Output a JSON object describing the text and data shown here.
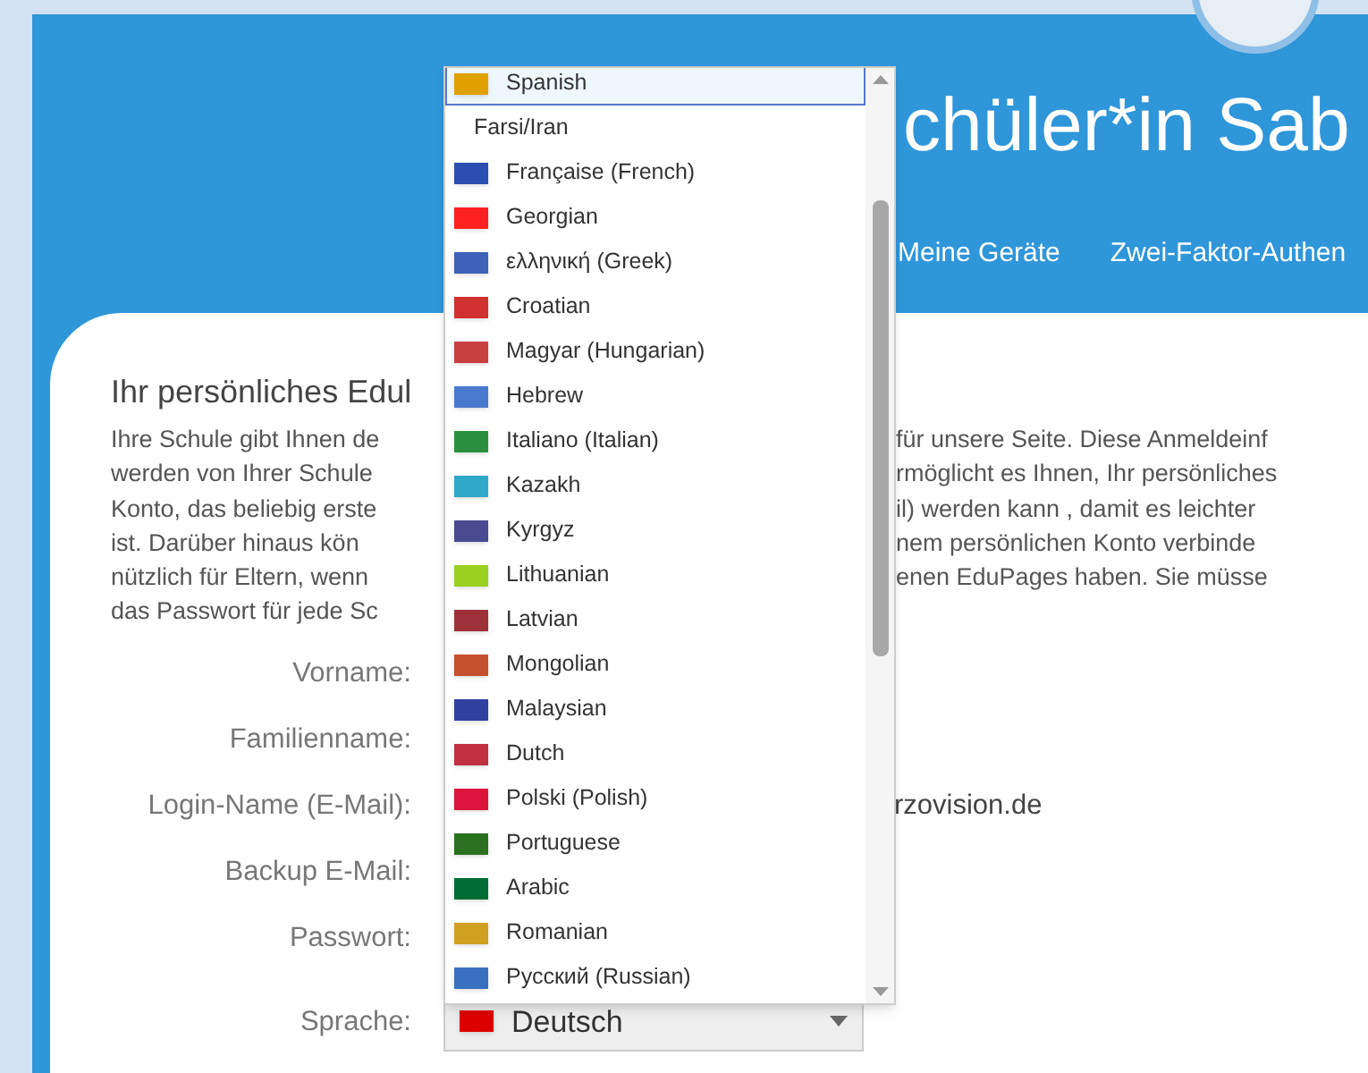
{
  "header": {
    "title": "chüler*in Sab",
    "nav": [
      "Meine Geräte",
      "Zwei-Faktor-Authen"
    ]
  },
  "intro": {
    "heading": "Ihr persönliches Edul",
    "lines": [
      {
        "left": "Ihre Schule gibt Ihnen de",
        "right": "für unsere Seite. Diese Anmeldeinf"
      },
      {
        "left": "werden von Ihrer Schule",
        "right": "rmöglicht es Ihnen, Ihr persönliches"
      },
      {
        "left": "Konto, das beliebig erste",
        "right": "il) werden kann , damit es leichter"
      },
      {
        "left": "ist. Darüber hinaus kön",
        "right": "nem persönlichen Konto verbinde"
      },
      {
        "left": "nützlich für Eltern, wenn",
        "right": "enen EduPages haben. Sie müsse"
      },
      {
        "left": "das Passwort für jede Sc"
      }
    ]
  },
  "form": [
    {
      "label": "Vorname:"
    },
    {
      "label": "Familienname:"
    },
    {
      "label": "Login-Name (E-Mail):",
      "value": "rzovision.de"
    },
    {
      "label": "Backup E-Mail:"
    },
    {
      "label": "Passwort:"
    },
    {
      "label": "Sprache:",
      "kind": "select"
    }
  ],
  "language_select": {
    "value": "Deutsch",
    "color": "#dd0000",
    "options": [
      {
        "label": "Spanish",
        "selected": true,
        "color": "#e0a000"
      },
      {
        "label": "Farsi/Iran",
        "selected": false
      },
      {
        "label": "Française (French)",
        "selected": false,
        "color": "#2a4fb0"
      },
      {
        "label": "Georgian",
        "selected": false,
        "color": "#ff2020"
      },
      {
        "label": "ελληνική (Greek)",
        "selected": false,
        "color": "#3d62b8"
      },
      {
        "label": "Croatian",
        "selected": false,
        "color": "#d03030"
      },
      {
        "label": "Magyar (Hungarian)",
        "selected": false,
        "color": "#c84040"
      },
      {
        "label": "Hebrew",
        "selected": false,
        "color": "#4a7ad0"
      },
      {
        "label": "Italiano (Italian)",
        "selected": false,
        "color": "#2a9040"
      },
      {
        "label": "Kazakh",
        "selected": false,
        "color": "#30a8c8"
      },
      {
        "label": "Kyrgyz",
        "selected": false,
        "color": "#4a4a90"
      },
      {
        "label": "Lithuanian",
        "selected": false,
        "color": "#9cd020"
      },
      {
        "label": "Latvian",
        "selected": false,
        "color": "#9e3039"
      },
      {
        "label": "Mongolian",
        "selected": false,
        "color": "#c4502f"
      },
      {
        "label": "Malaysian",
        "selected": false,
        "color": "#3040a0"
      },
      {
        "label": "Dutch",
        "selected": false,
        "color": "#c03040"
      },
      {
        "label": "Polski (Polish)",
        "selected": false,
        "color": "#dc143c"
      },
      {
        "label": "Portuguese",
        "selected": false,
        "color": "#2a7020"
      },
      {
        "label": "Arabic",
        "selected": false,
        "color": "#006c35"
      },
      {
        "label": "Romanian",
        "selected": false,
        "color": "#d0a020"
      },
      {
        "label": "Русский (Russian)",
        "selected": false,
        "color": "#3a70c0"
      }
    ]
  }
}
